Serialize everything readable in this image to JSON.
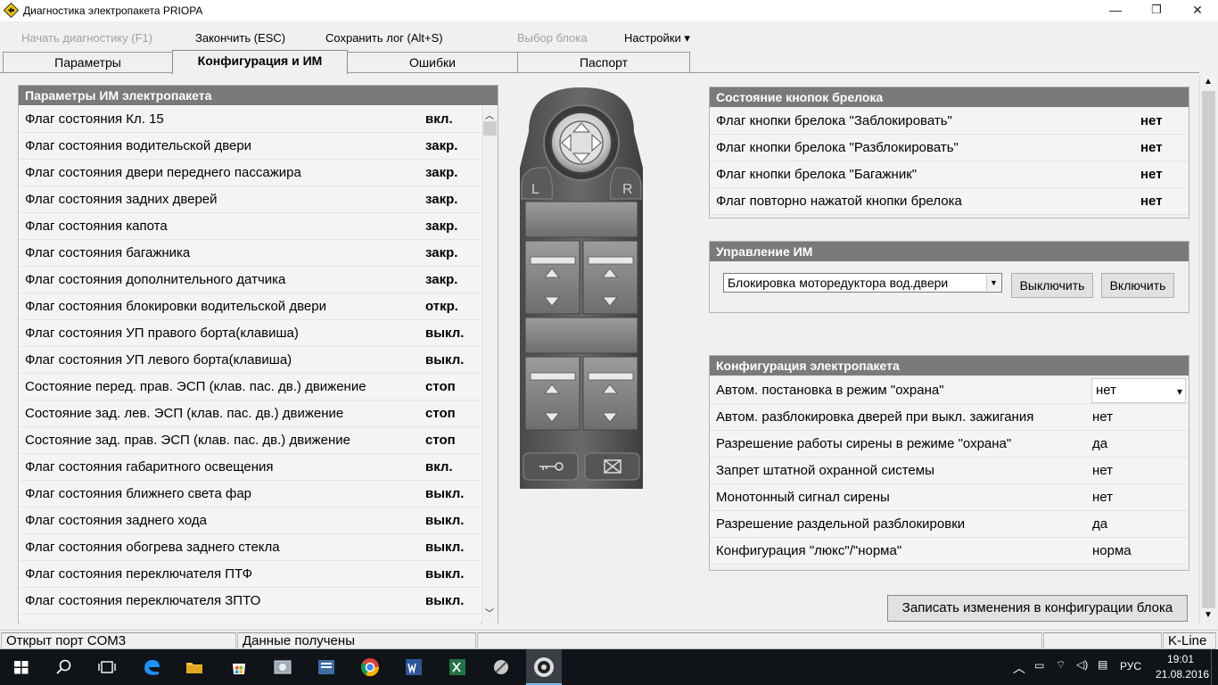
{
  "window": {
    "title": "Диагностика электропакета PRIOPA",
    "minimize": "—",
    "maximize": "❐",
    "close": "✕"
  },
  "menu": [
    {
      "label": "Начать диагностику (F1)",
      "enabled": false
    },
    {
      "label": "Закончить (ESC)",
      "enabled": true
    },
    {
      "label": "Сохранить лог (Alt+S)",
      "enabled": true
    },
    {
      "label": "Выбор блока",
      "enabled": false
    },
    {
      "label": "Настройки ▾",
      "enabled": true
    }
  ],
  "tabs": [
    {
      "label": "Параметры",
      "active": false
    },
    {
      "label": "Конфигурация и ИМ",
      "active": true
    },
    {
      "label": "Ошибки",
      "active": false
    },
    {
      "label": "Паспорт",
      "active": false
    }
  ],
  "im_params": {
    "title": "Параметры ИМ электропакета",
    "rows": [
      {
        "label": "Флаг состояния Кл. 15",
        "value": "вкл."
      },
      {
        "label": "Флаг состояния водительской двери",
        "value": "закр."
      },
      {
        "label": "Флаг состояния двери переднего пассажира",
        "value": "закр."
      },
      {
        "label": "Флаг состояния задних дверей",
        "value": "закр."
      },
      {
        "label": "Флаг состояния капота",
        "value": "закр."
      },
      {
        "label": "Флаг состояния багажника",
        "value": "закр."
      },
      {
        "label": "Флаг состояния дополнительного датчика",
        "value": "закр."
      },
      {
        "label": "Флаг состояния блокировки водительской двери",
        "value": "откр."
      },
      {
        "label": "Флаг состояния УП правого борта(клавиша)",
        "value": "выкл."
      },
      {
        "label": "Флаг состояния УП левого борта(клавиша)",
        "value": "выкл."
      },
      {
        "label": "Состояние перед. прав. ЭСП (клав. пас. дв.) движение",
        "value": "стоп"
      },
      {
        "label": "Состояние зад. лев. ЭСП (клав. пас. дв.) движение",
        "value": "стоп"
      },
      {
        "label": "Состояние зад. прав. ЭСП (клав. пас. дв.) движение",
        "value": "стоп"
      },
      {
        "label": "Флаг состояния габаритного освещения",
        "value": "вкл."
      },
      {
        "label": "Флаг состояния ближнего света фар",
        "value": "выкл."
      },
      {
        "label": "Флаг состояния заднего хода",
        "value": "выкл."
      },
      {
        "label": "Флаг состояния обогрева заднего стекла",
        "value": "выкл."
      },
      {
        "label": "Флаг состояния переключателя ПТФ",
        "value": "выкл."
      },
      {
        "label": "Флаг состояния переключателя ЗПТО",
        "value": "выкл."
      }
    ]
  },
  "keypad": {
    "left_label": "L",
    "right_label": "R"
  },
  "fob": {
    "title": "Состояние кнопок брелока",
    "rows": [
      {
        "label": "Флаг кнопки брелока \"Заблокировать\"",
        "value": "нет"
      },
      {
        "label": "Флаг кнопки брелока \"Разблокировать\"",
        "value": "нет"
      },
      {
        "label": "Флаг кнопки брелока \"Багажник\"",
        "value": "нет"
      },
      {
        "label": "Флаг повторно нажатой кнопки брелока",
        "value": "нет"
      }
    ]
  },
  "im_control": {
    "title": "Управление ИМ",
    "selected": "Блокировка моторедуктора вод.двери",
    "off_label": "Выключить",
    "on_label": "Включить"
  },
  "config": {
    "title": "Конфигурация электропакета",
    "rows": [
      {
        "label": "Автом. постановка в режим \"охрана\"",
        "value": "нет"
      },
      {
        "label": "Автом. разблокировка дверей при выкл. зажигания",
        "value": "нет"
      },
      {
        "label": "Разрешение работы сирены в режиме \"охрана\"",
        "value": "да"
      },
      {
        "label": "Запрет штатной охранной системы",
        "value": "нет"
      },
      {
        "label": "Монотонный сигнал сирены",
        "value": "нет"
      },
      {
        "label": "Разрешение раздельной разблокировки",
        "value": "да"
      },
      {
        "label": "Конфигурация \"люкс\"/\"норма\"",
        "value": "норма"
      }
    ],
    "write_label": "Записать изменения в конфигурации блока"
  },
  "status": {
    "port": "Открыт порт COM3",
    "data": "Данные получены",
    "interface": "K-Line"
  },
  "taskbar": {
    "lang": "РУС",
    "time": "19:01",
    "date": "21.08.2016"
  },
  "colors": {
    "panel_header": "#7a7a7a",
    "taskbar": "#101418",
    "row_bg": "#f4f4f4"
  }
}
